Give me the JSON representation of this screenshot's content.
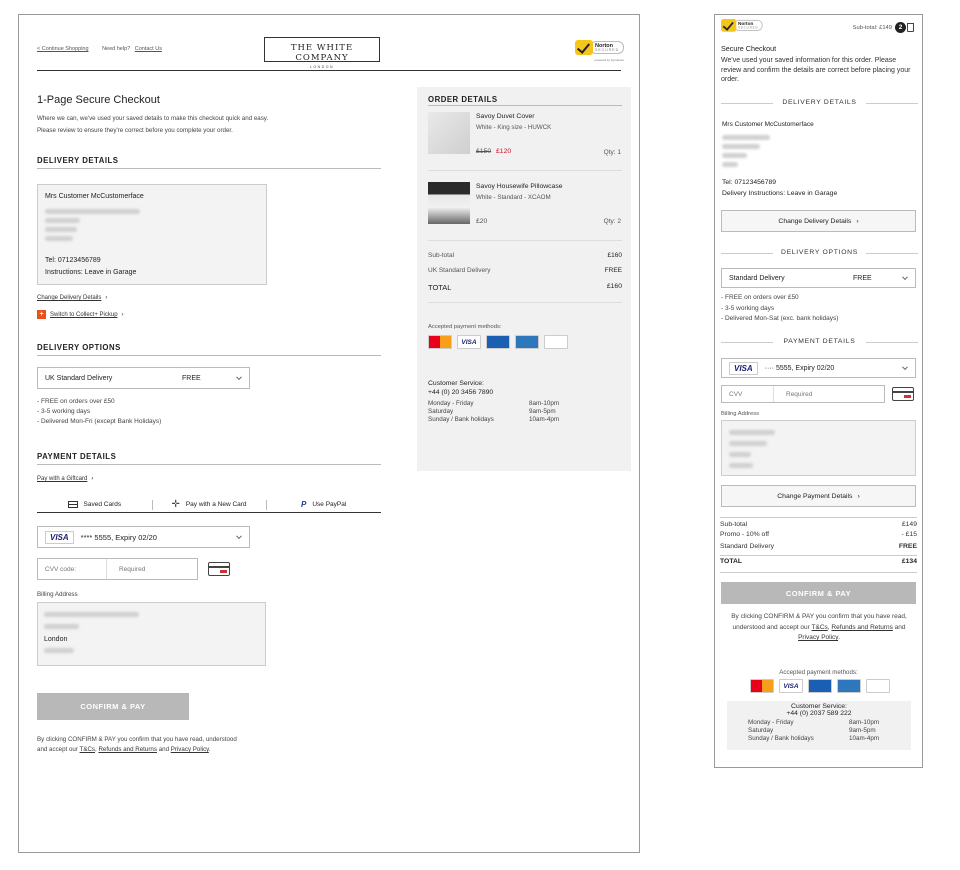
{
  "brand": {
    "line1": "THE WHITE COMPANY",
    "line2": "LONDON"
  },
  "norton": {
    "title": "Norton",
    "sub": "SECURED",
    "by": "powered by Symantec"
  },
  "topnav": {
    "continue": "< Continue Shopping",
    "help_prefix": "Need help?",
    "contact": "Contact Us"
  },
  "page": {
    "title": "1-Page Secure Checkout",
    "intro1": "Where we can, we've used your saved details to make this checkout quick and easy.",
    "intro2": "Please review to ensure they're correct before you complete your order."
  },
  "delivery_details": {
    "heading": "DELIVERY DETAILS",
    "name": "Mrs Customer McCustomerface",
    "tel": "Tel: 07123456789",
    "instructions": "Instructions: Leave in Garage",
    "change_link": "Change Delivery Details",
    "collect_link": "Switch to Collect+ Pickup",
    "collect_icon": "collect-plus-icon"
  },
  "delivery_options": {
    "heading": "DELIVERY OPTIONS",
    "selected": "UK Standard Delivery",
    "price": "FREE",
    "notes": [
      "- FREE on orders over £50",
      "- 3-5 working days",
      "- Delivered Mon-Fri (except Bank Holidays)"
    ]
  },
  "payment": {
    "heading": "PAYMENT DETAILS",
    "giftcard": "Pay with a Giftcard",
    "tabs": [
      "Saved Cards",
      "Pay with a New Card",
      "Use PayPal"
    ],
    "card_brand": "VISA",
    "card": "**** 5555, Expiry 02/20",
    "cvv_label": "CVV code:",
    "cvv_placeholder": "Required",
    "billing_label": "Billing Address",
    "billing_city": "London"
  },
  "confirm": {
    "button": "CONFIRM & PAY",
    "legal_1": "By clicking CONFIRM & PAY you confirm that you have read, understood",
    "legal_2_prefix": "and accept our",
    "tcs": "T&Cs",
    "refunds": "Refunds and Returns",
    "and": "and",
    "privacy": "Privacy Policy"
  },
  "order": {
    "heading": "ORDER DETAILS",
    "items": [
      {
        "name": "Savoy Duvet Cover",
        "desc": "White - King size - HUWCK",
        "was": "£150",
        "now": "£120",
        "qty": "Qty:  1"
      },
      {
        "name": "Savoy Housewife Pillowcase",
        "desc": "White - Standard - XCAOM",
        "now": "£20",
        "qty": "Qty:  2"
      }
    ],
    "subtotal_label": "Sub-total",
    "subtotal": "£160",
    "delivery_label": "UK Standard Delivery",
    "delivery": "FREE",
    "total_label": "TOTAL",
    "total": "£160",
    "pay_methods_label": "Accepted payment methods:",
    "pay_methods": [
      "MasterCard",
      "VISA",
      "Maestro",
      "AMEX",
      "PayPal"
    ],
    "cs_title": "Customer Service:",
    "cs_phone": "+44 (0) 20 3456 7890",
    "hours": [
      [
        "Monday - Friday",
        "8am-10pm"
      ],
      [
        "Saturday",
        "9am-5pm"
      ],
      [
        "Sunday / Bank holidays",
        "10am-4pm"
      ]
    ]
  },
  "mobile": {
    "subtotal": "Sub-total: £149",
    "bag_count": "2",
    "title": "Secure Checkout",
    "intro": "We've used your saved information for this order. Please review and confirm the details are correct before placing your order.",
    "delivery_details_heading": "DELIVERY DETAILS",
    "name": "Mrs Customer McCustomerface",
    "tel": "Tel: 07123456789",
    "instructions": "Delivery Instructions: Leave in Garage",
    "change_delivery": "Change Delivery Details",
    "delivery_options_heading": "DELIVERY OPTIONS",
    "delivery_selected": "Standard Delivery",
    "delivery_price": "FREE",
    "delivery_notes": [
      "- FREE on orders over £50",
      "- 3-5 working days",
      "- Delivered Mon-Sat (exc. bank holidays)"
    ],
    "payment_heading": "PAYMENT DETAILS",
    "card_brand": "VISA",
    "card": "···· 5555, Expiry 02/20",
    "cvv_label": "CVV",
    "cvv_placeholder": "Required",
    "billing_label": "Billing Address",
    "change_payment": "Change Payment Details",
    "summary": [
      {
        "label": "Sub-total",
        "value": "£149"
      },
      {
        "label": "Promo - 10% off",
        "value": "- £15"
      },
      {
        "label": "Standard Delivery",
        "value": "FREE"
      }
    ],
    "total_label": "TOTAL",
    "total": "£134",
    "confirm": "CONFIRM & PAY",
    "legal_prefix": "By clicking CONFIRM & PAY you confirm that you have read, understood and accept our",
    "tcs": "T&Cs",
    "refunds": "Refunds and Returns",
    "and": "and",
    "privacy": "Privacy Policy",
    "pay_methods_label": "Accepted payment methods:",
    "cs_title": "Customer Service:",
    "cs_phone": "+44 (0) 2037 589 222",
    "hours": [
      [
        "Monday - Friday",
        "8am-10pm"
      ],
      [
        "Saturday",
        "9am-5pm"
      ],
      [
        "Sunday / Bank holidays",
        "10am-4pm"
      ]
    ]
  }
}
